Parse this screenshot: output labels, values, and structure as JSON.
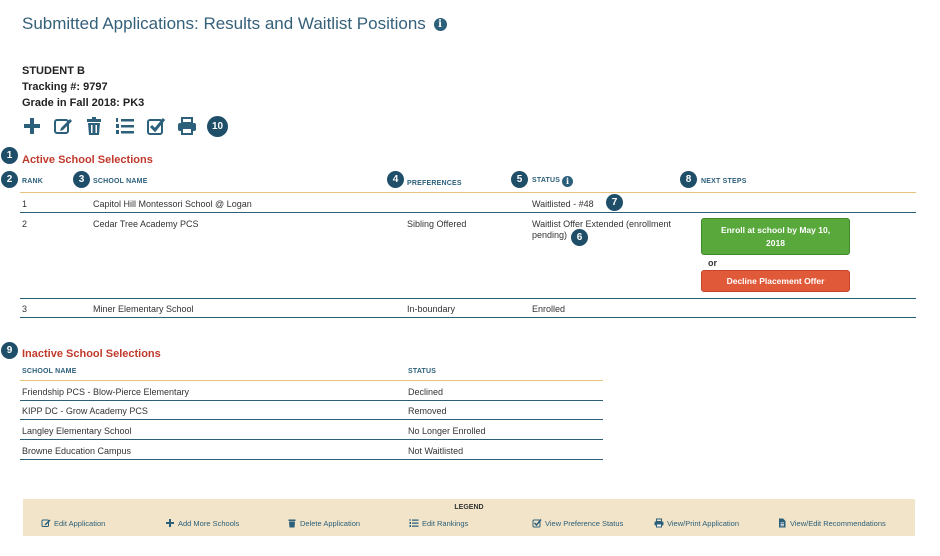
{
  "page": {
    "title": "Submitted Applications: Results and Waitlist Positions",
    "title_info_glyph": "i"
  },
  "student": {
    "name": "STUDENT B",
    "tracking": "Tracking #: 9797",
    "grade": "Grade in Fall 2018: PK3"
  },
  "toolbar": {
    "items": [
      {
        "name": "add-icon",
        "title": "Add More Schools"
      },
      {
        "name": "edit-icon",
        "title": "Edit Application"
      },
      {
        "name": "trash-icon",
        "title": "Delete Application"
      },
      {
        "name": "list-numbered-icon",
        "title": "Edit Rankings"
      },
      {
        "name": "checkbox-icon",
        "title": "View Preference Status"
      },
      {
        "name": "printer-icon",
        "title": "View/Print Application"
      }
    ]
  },
  "badges": [
    "1",
    "2",
    "3",
    "4",
    "5",
    "6",
    "7",
    "8",
    "9",
    "10"
  ],
  "active": {
    "title": "Active School Selections",
    "headers": {
      "rank": "RANK",
      "school": "SCHOOL NAME",
      "preferences": "PREFERENCES",
      "status": "STATUS",
      "next": "NEXT STEPS"
    },
    "rows": [
      {
        "rank": "1",
        "school": "Capitol Hill Montessori School @ Logan",
        "preference": "",
        "status": "Waitlisted - #48"
      },
      {
        "rank": "2",
        "school": "Cedar Tree Academy PCS",
        "preference": "Sibling Offered",
        "status_line1": "Waitlist Offer Extended (enrollment",
        "status_line2": "pending)"
      },
      {
        "rank": "3",
        "school": "Miner Elementary School",
        "preference": "In-boundary",
        "status": "Enrolled"
      }
    ],
    "enroll_button": {
      "line1": "Enroll at school by May 10,",
      "line2": "2018"
    },
    "or_text": "or",
    "decline_button": "Decline Placement Offer"
  },
  "inactive": {
    "title": "Inactive School Selections",
    "headers": {
      "school": "SCHOOL NAME",
      "status": "STATUS"
    },
    "rows": [
      {
        "school": "Friendship PCS - Blow-Pierce Elementary",
        "status": "Declined"
      },
      {
        "school": "KIPP DC - Grow Academy PCS",
        "status": "Removed"
      },
      {
        "school": "Langley Elementary School",
        "status": "No Longer Enrolled"
      },
      {
        "school": "Browne Education Campus",
        "status": "Not Waitlisted"
      }
    ]
  },
  "legend": {
    "title": "LEGEND",
    "items": [
      {
        "icon": "edit-icon",
        "label": "Edit Application"
      },
      {
        "icon": "add-icon",
        "label": "Add More Schools"
      },
      {
        "icon": "trash-icon",
        "label": "Delete Application"
      },
      {
        "icon": "list-numbered-icon",
        "label": "Edit Rankings"
      },
      {
        "icon": "checkbox-icon",
        "label": "View Preference Status"
      },
      {
        "icon": "printer-icon",
        "label": "View/Print Application"
      },
      {
        "icon": "document-icon",
        "label": "View/Edit Recommendations"
      }
    ]
  },
  "colors": {
    "title": "#35607a",
    "section": "#c0392b",
    "accent": "#2b5f7a",
    "badge": "#1f4e69",
    "green_button": "#59a83c",
    "red_button": "#e05a3a",
    "legend_bg": "#f2e4c8",
    "header_rule": "#e8c27a"
  }
}
